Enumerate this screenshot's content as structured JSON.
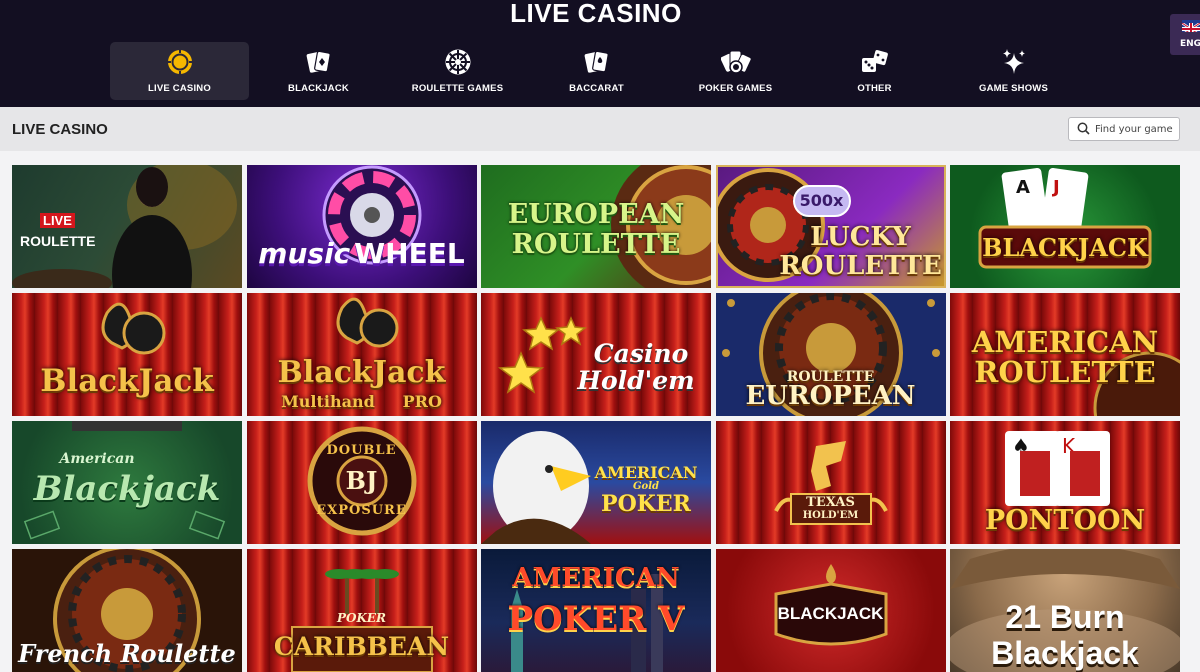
{
  "header": {
    "title": "LIVE CASINO",
    "nav": [
      {
        "label": "LIVE CASINO",
        "icon": "chip-icon",
        "active": true
      },
      {
        "label": "BLACKJACK",
        "icon": "cards-icon",
        "active": false
      },
      {
        "label": "ROULETTE GAMES",
        "icon": "roulette-icon",
        "active": false
      },
      {
        "label": "BACCARAT",
        "icon": "baccarat-cards-icon",
        "active": false
      },
      {
        "label": "POKER GAMES",
        "icon": "poker-icon",
        "active": false
      },
      {
        "label": "OTHER",
        "icon": "dice-icon",
        "active": false
      },
      {
        "label": "GAME SHOWS",
        "icon": "sparkles-icon",
        "active": false
      }
    ],
    "language": "ENG"
  },
  "section": {
    "title": "LIVE CASINO",
    "search_placeholder": "Find your game"
  },
  "games": [
    {
      "name": "LIVE ROULETTE",
      "line1": "LIVE",
      "line2": "ROULETTE"
    },
    {
      "name": "Music Wheel",
      "line1": "music",
      "line2": "WHEEL"
    },
    {
      "name": "European Roulette",
      "line1": "EUROPEAN",
      "line2": "ROULETTE"
    },
    {
      "name": "Lucky Roulette",
      "badge": "500x",
      "line1": "LUCKY",
      "line2": "ROULETTE"
    },
    {
      "name": "BlackJack",
      "line1": "BLACKJACK"
    },
    {
      "name": "BlackJack",
      "line1": "BlackJack"
    },
    {
      "name": "BlackJack Multihand PRO",
      "line1": "BlackJack",
      "line2": "Multihand     PRO"
    },
    {
      "name": "Casino Hold'em",
      "line1": "Casino",
      "line2": "Hold'em"
    },
    {
      "name": "Roulette European",
      "line1": "ROULETTE",
      "line2": "EUROPEAN"
    },
    {
      "name": "American Roulette",
      "line1": "AMERICAN",
      "line2": "ROULETTE"
    },
    {
      "name": "American Blackjack",
      "line1": "American",
      "line2": "Blackjack"
    },
    {
      "name": "Double Exposure",
      "line1": "DOUBLE",
      "badge": "BJ",
      "line2": "EXPOSURE"
    },
    {
      "name": "American Gold Poker",
      "line1": "AMERICAN",
      "line2": "Gold",
      "line3": "POKER"
    },
    {
      "name": "Texas Hold'em",
      "line1": "TEXAS",
      "line2": "HOLD'EM"
    },
    {
      "name": "Pontoon",
      "line1": "PONTOON"
    },
    {
      "name": "French Roulette",
      "line1": "French Roulette"
    },
    {
      "name": "Caribbean Poker",
      "line1": "POKER",
      "line2": "CARIBBEAN"
    },
    {
      "name": "American Poker V",
      "line1": "AMERICAN",
      "line2": "POKER V"
    },
    {
      "name": "BlackJack",
      "line1": "BLACKJACK"
    },
    {
      "name": "21 Burn Blackjack",
      "line1": "21 Burn",
      "line2": "Blackjack"
    }
  ],
  "colors": {
    "header_bg": "#130f22",
    "accent_gold": "#f5b700",
    "section_bg": "#e6e6e8"
  }
}
